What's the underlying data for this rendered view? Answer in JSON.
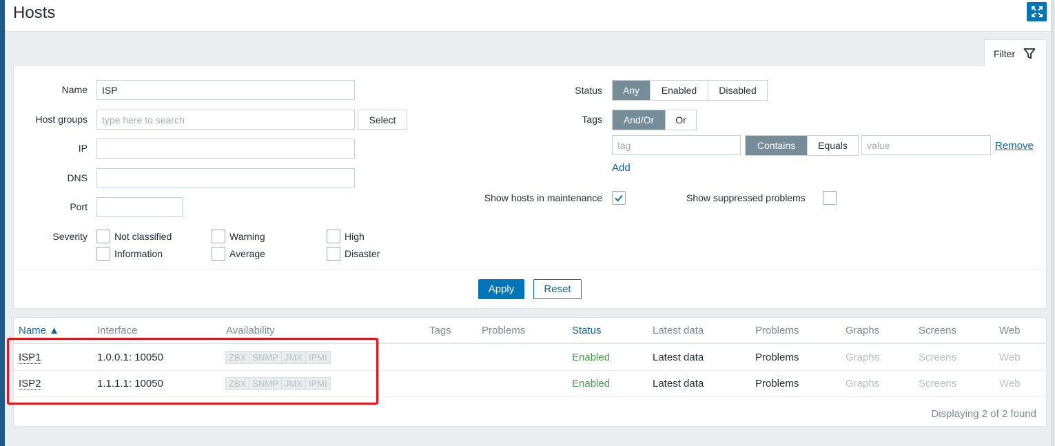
{
  "header": {
    "title": "Hosts"
  },
  "filter_tab": {
    "label": "Filter"
  },
  "filter": {
    "name_label": "Name",
    "name_value": "ISP",
    "host_groups_label": "Host groups",
    "host_groups_placeholder": "type here to search",
    "select_label": "Select",
    "ip_label": "IP",
    "ip_value": "",
    "dns_label": "DNS",
    "dns_value": "",
    "port_label": "Port",
    "port_value": "",
    "severity_label": "Severity",
    "severities": [
      "Not classified",
      "Warning",
      "High",
      "Information",
      "Average",
      "Disaster"
    ],
    "status_label": "Status",
    "status_options": [
      "Any",
      "Enabled",
      "Disabled"
    ],
    "status_selected": "Any",
    "tags_label": "Tags",
    "tags_options": [
      "And/Or",
      "Or"
    ],
    "tags_selected": "And/Or",
    "tag_placeholder": "tag",
    "tag_operators": [
      "Contains",
      "Equals"
    ],
    "tag_operator_selected": "Contains",
    "value_placeholder": "value",
    "remove_label": "Remove",
    "add_label": "Add",
    "show_maintenance_label": "Show hosts in maintenance",
    "show_maintenance_checked": true,
    "show_suppressed_label": "Show suppressed problems",
    "show_suppressed_checked": false,
    "apply_label": "Apply",
    "reset_label": "Reset"
  },
  "table": {
    "columns": [
      "Name ▲",
      "Interface",
      "Availability",
      "Tags",
      "Problems",
      "Status",
      "Latest data",
      "Problems",
      "Graphs",
      "Screens",
      "Web"
    ],
    "rows": [
      {
        "name": "ISP1",
        "interface": "1.0.0.1: 10050",
        "availability": [
          "ZBX",
          "SNMP",
          "JMX",
          "IPMI"
        ],
        "status": "Enabled",
        "latest_data": "Latest data",
        "problems": "Problems",
        "graphs": "Graphs",
        "screens": "Screens",
        "web": "Web"
      },
      {
        "name": "ISP2",
        "interface": "1.1.1.1: 10050",
        "availability": [
          "ZBX",
          "SNMP",
          "JMX",
          "IPMI"
        ],
        "status": "Enabled",
        "latest_data": "Latest data",
        "problems": "Problems",
        "graphs": "Graphs",
        "screens": "Screens",
        "web": "Web"
      }
    ],
    "footer": "Displaying 2 of 2 found"
  },
  "colors": {
    "accent": "#0275b8",
    "enabled": "#429e47",
    "highlight": "#e8141b"
  }
}
